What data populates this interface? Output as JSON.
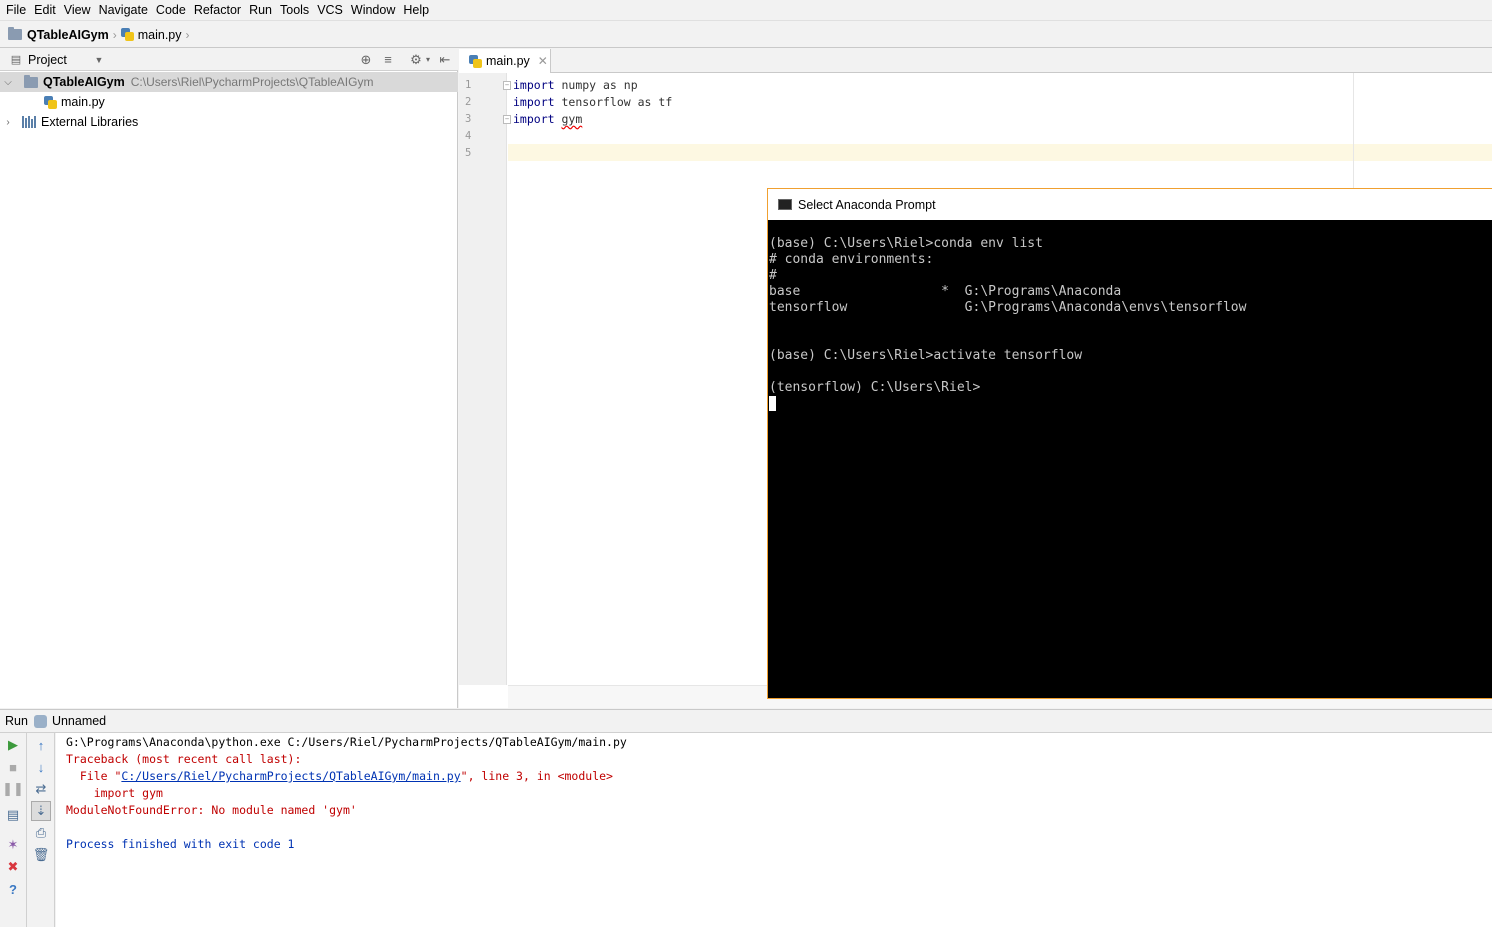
{
  "menu": [
    "File",
    "Edit",
    "View",
    "Navigate",
    "Code",
    "Refactor",
    "Run",
    "Tools",
    "VCS",
    "Window",
    "Help"
  ],
  "breadcrumb": {
    "project": "QTableAIGym",
    "file": "main.py"
  },
  "project_panel": {
    "title": "Project",
    "root": {
      "name": "QTableAIGym",
      "path": "C:\\Users\\Riel\\PycharmProjects\\QTableAIGym"
    },
    "file": "main.py",
    "libraries": "External Libraries"
  },
  "editor": {
    "tab": "main.py",
    "line_numbers": [
      "1",
      "2",
      "3",
      "4",
      "5"
    ],
    "lines": [
      {
        "kw": "import",
        "rest": " numpy as np"
      },
      {
        "kw": "import",
        "rest": " tensorflow as tf"
      },
      {
        "kw": "import",
        "rest": " ",
        "err": "gym"
      }
    ]
  },
  "console": {
    "title": "Select Anaconda Prompt",
    "lines": [
      "(base) C:\\Users\\Riel>conda env list",
      "# conda environments:",
      "#",
      "base                  *  G:\\Programs\\Anaconda",
      "tensorflow               G:\\Programs\\Anaconda\\envs\\tensorflow",
      "",
      "",
      "(base) C:\\Users\\Riel>activate tensorflow",
      "",
      "(tensorflow) C:\\Users\\Riel>"
    ]
  },
  "run_panel": {
    "label": "Run",
    "config": "Unnamed",
    "output": {
      "cmd": "G:\\Programs\\Anaconda\\python.exe C:/Users/Riel/PycharmProjects/QTableAIGym/main.py",
      "traceback": "Traceback (most recent call last):",
      "file_prefix": "  File \"",
      "file_link": "C:/Users/Riel/PycharmProjects/QTableAIGym/main.py",
      "file_suffix": "\", line 3, in <module>",
      "import_line": "    import gym",
      "error": "ModuleNotFoundError: No module named 'gym'",
      "finished": "Process finished with exit code 1"
    }
  },
  "colors": {
    "console_border": "#f0a030",
    "error_red": "#c00000",
    "link_blue": "#0033b3",
    "caret_line": "#fdf8e2"
  }
}
